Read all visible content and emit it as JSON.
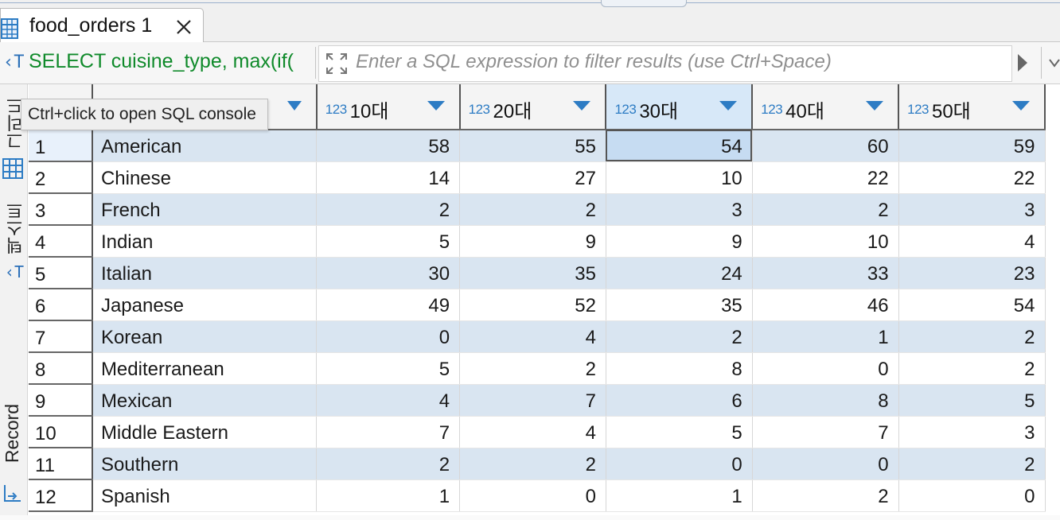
{
  "tab": {
    "title": "food_orders 1"
  },
  "filter": {
    "sql_text": "SELECT cuisine_type, max(if(",
    "placeholder": "Enter a SQL expression to filter results (use Ctrl+Space)"
  },
  "left_toolbar": {
    "grid_label": "그리드",
    "text_label": "텍스트",
    "record_label": "Record"
  },
  "tooltip": {
    "text": "Ctrl+click to open SQL console"
  },
  "grid": {
    "type_badge": "123",
    "columns": [
      "10대",
      "20대",
      "30대",
      "40대",
      "50대"
    ],
    "selected_column": "30대",
    "rows": [
      {
        "num": "1",
        "cuisine": "American",
        "v": [
          "58",
          "55",
          "54",
          "60",
          "59"
        ]
      },
      {
        "num": "2",
        "cuisine": "Chinese",
        "v": [
          "14",
          "27",
          "10",
          "22",
          "22"
        ]
      },
      {
        "num": "3",
        "cuisine": "French",
        "v": [
          "2",
          "2",
          "3",
          "2",
          "3"
        ]
      },
      {
        "num": "4",
        "cuisine": "Indian",
        "v": [
          "5",
          "9",
          "9",
          "10",
          "4"
        ]
      },
      {
        "num": "5",
        "cuisine": "Italian",
        "v": [
          "30",
          "35",
          "24",
          "33",
          "23"
        ]
      },
      {
        "num": "6",
        "cuisine": "Japanese",
        "v": [
          "49",
          "52",
          "35",
          "46",
          "54"
        ]
      },
      {
        "num": "7",
        "cuisine": "Korean",
        "v": [
          "0",
          "4",
          "2",
          "1",
          "2"
        ]
      },
      {
        "num": "8",
        "cuisine": "Mediterranean",
        "v": [
          "5",
          "2",
          "8",
          "0",
          "2"
        ]
      },
      {
        "num": "9",
        "cuisine": "Mexican",
        "v": [
          "4",
          "7",
          "6",
          "8",
          "5"
        ]
      },
      {
        "num": "10",
        "cuisine": "Middle Eastern",
        "v": [
          "7",
          "4",
          "5",
          "7",
          "3"
        ]
      },
      {
        "num": "11",
        "cuisine": "Southern",
        "v": [
          "2",
          "2",
          "0",
          "0",
          "2"
        ]
      },
      {
        "num": "12",
        "cuisine": "Spanish",
        "v": [
          "1",
          "0",
          "1",
          "2",
          "0"
        ]
      }
    ]
  },
  "colors": {
    "accent": "#2d7cc4",
    "row_alt": "#d9e5f1",
    "sql_green": "#0f8a2a",
    "selected": "#c6dcf2"
  }
}
